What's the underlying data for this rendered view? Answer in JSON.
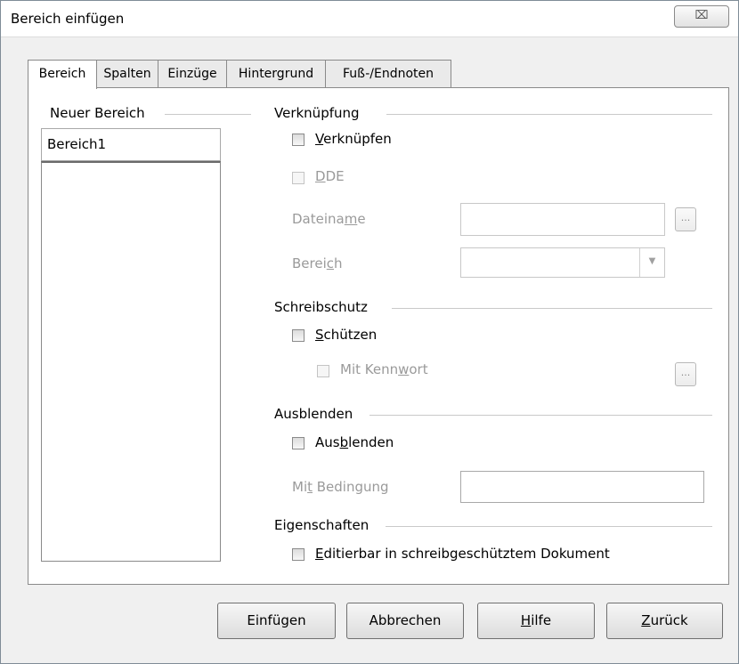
{
  "window": {
    "title": "Bereich einfügen",
    "close_glyph": "⌧"
  },
  "tabs": [
    {
      "label": "Bereich"
    },
    {
      "label": "Spalten"
    },
    {
      "label": "Einzüge"
    },
    {
      "label": "Hintergrund"
    },
    {
      "label": "Fuß-/Endnoten"
    }
  ],
  "left": {
    "heading": "Neuer Bereich",
    "name_value": "Bereich1"
  },
  "link": {
    "heading": "Verknüpfung",
    "link_label_hot": "V",
    "link_label_rest": "erknüpfen",
    "dde_hot": "D",
    "dde_rest": "DE",
    "filename_pre": "Dateina",
    "filename_hot": "m",
    "filename_post": "e",
    "range_pre": "Berei",
    "range_hot": "c",
    "range_post": "h",
    "browse_glyph": "...",
    "dropdown_glyph": "▼"
  },
  "protect": {
    "heading": "Schreibschutz",
    "protect_hot": "S",
    "protect_rest": "chützen",
    "password_pre": "Mit Kenn",
    "password_hot": "w",
    "password_post": "ort",
    "browse_glyph": "..."
  },
  "hide": {
    "heading": "Ausblenden",
    "hide_pre": "Aus",
    "hide_hot": "b",
    "hide_post": "lenden",
    "condition_pre": "Mi",
    "condition_hot": "t",
    "condition_post": " Bedingung"
  },
  "props": {
    "heading": "Eigenschaften",
    "editable_hot": "E",
    "editable_rest": "ditierbar in schreibgeschütztem Dokument"
  },
  "buttons": {
    "insert": "Einfügen",
    "cancel": "Abbrechen",
    "help_hot": "H",
    "help_rest": "ilfe",
    "back_hot": "Z",
    "back_rest": "urück"
  }
}
